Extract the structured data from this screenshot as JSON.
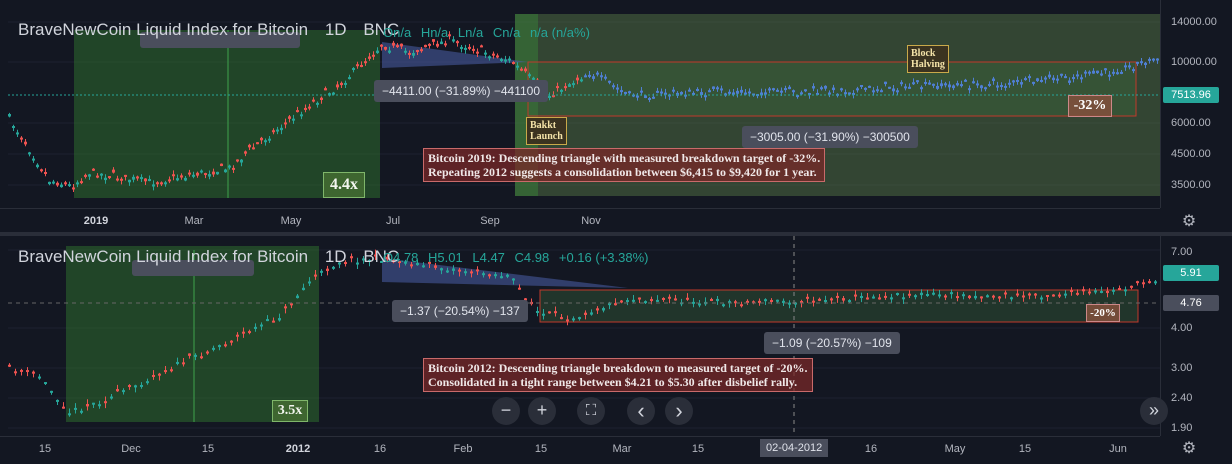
{
  "top": {
    "symbol": "BraveNewCoin Liquid Index for Bitcoin",
    "interval": "1D",
    "exchange": "BNC",
    "ohlc": {
      "o": "On/a",
      "h": "Hn/a",
      "l": "Ln/a",
      "c": "Cn/a",
      "chg": "n/a (n/a%)"
    },
    "price_ticks": [
      "14000.00",
      "10000.00",
      "6000.00",
      "4500.00",
      "3500.00"
    ],
    "current_price": "7513.96",
    "time_ticks": [
      "2019",
      "Mar",
      "May",
      "Jul",
      "Sep",
      "Nov"
    ],
    "measure_left": "−4411.00 (−31.89%) −441100",
    "measure_right": "−3005.00 (−31.90%) −300500",
    "multiplier": "4.4x",
    "target_tag": "-32%",
    "event_bakkt": [
      "Bakkt",
      "Launch"
    ],
    "event_halving": [
      "Block",
      "Halving"
    ],
    "note_line1": "Bitcoin 2019: Descending triangle with measured breakdown target of -32%.",
    "note_line2": "Repeating 2012 suggests a consolidation between $6,415 to $9,420 for 1 year."
  },
  "bottom": {
    "symbol": "BraveNewCoin Liquid Index for Bitcoin",
    "interval": "1D",
    "exchange": "BNC",
    "ohlc": {
      "o": "O4.78",
      "h": "H5.01",
      "l": "L4.47",
      "c": "C4.98",
      "chg": "+0.16 (+3.38%)"
    },
    "price_ticks": [
      "7.00",
      "4.00",
      "3.00",
      "2.40",
      "1.90"
    ],
    "current_price": "5.91",
    "crosshair_price": "4.76",
    "time_ticks": [
      "15",
      "Dec",
      "15",
      "2012",
      "16",
      "Feb",
      "15",
      "Mar",
      "15",
      "Apr",
      "16",
      "May",
      "15",
      "Jun"
    ],
    "crosshair_date": "02-04-2012",
    "measure_left": "−1.37 (−20.54%) −137",
    "measure_right": "−1.09 (−20.57%) −109",
    "multiplier": "3.5x",
    "target_tag": "-20%",
    "note_line1": "Bitcoin 2012: Descending triangle breakdown to measured target of -20%.",
    "note_line2": "Consolidated in a tight range between $4.21 to $5.30 after disbelief rally."
  },
  "nav": {
    "zoom_out": "−",
    "zoom_in": "+",
    "fullscreen": "⛶",
    "scroll_left": "‹",
    "scroll_right": "›",
    "reset": "»"
  },
  "colors": {
    "up": "#26a69a",
    "down": "#ef5350",
    "bar_blue": "#4f7fd3",
    "green_zone": "#2e6b2e",
    "red_line": "#c0392b"
  }
}
